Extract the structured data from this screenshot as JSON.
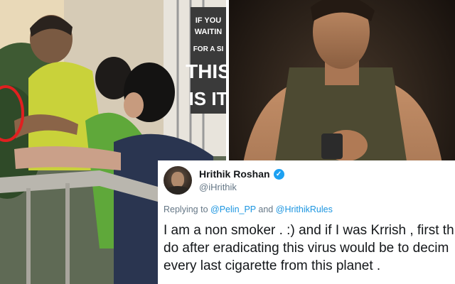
{
  "left_photo": {
    "sign_lines": [
      "IF YOU",
      "WAITIN",
      "FOR A SI",
      "THIS",
      "IS IT"
    ]
  },
  "tweet": {
    "display_name": "Hrithik Roshan",
    "verified_mark": "✓",
    "handle": "@iHrithik",
    "replying_prefix": "Replying to",
    "reply_to_1": "@Pelin_PP",
    "reply_and": "and",
    "reply_to_2": "@HrithikRules",
    "text_lines": [
      "I am a non smoker . :) and if I was Krrish , first th",
      "do after eradicating this virus would be to decim",
      "every last cigarette from this planet ."
    ]
  },
  "colors": {
    "verified_badge": "#1da1f2",
    "mention": "#1b95e0",
    "highlight_circle": "#e02020"
  }
}
